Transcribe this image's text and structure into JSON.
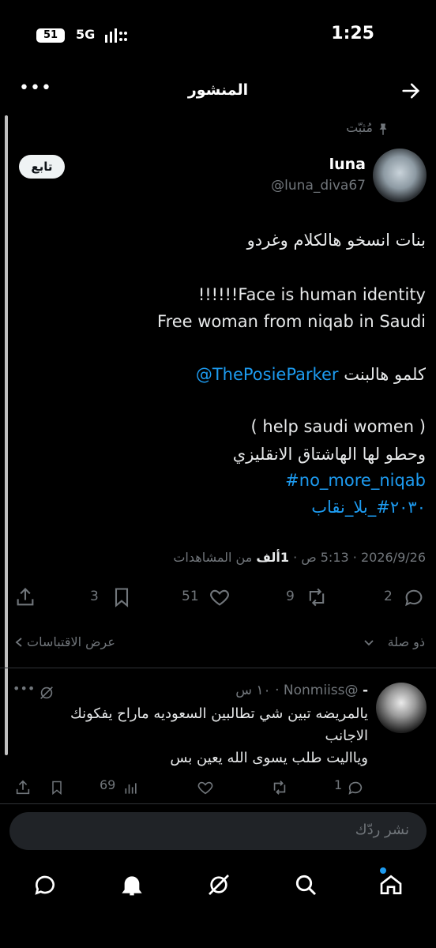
{
  "status_bar": {
    "time": "1:25",
    "battery": "51",
    "network": "5G"
  },
  "header": {
    "title": "المنشور"
  },
  "post": {
    "pinned_label": "مُثبّت",
    "author_name": "luna",
    "author_handle": "@luna_diva67",
    "follow_label": "تابع",
    "lines": {
      "l1": "بنات انسخو هالكلام وغردو",
      "l2": "!!!!!!Face is human identity",
      "l3": "Free woman from niqab in Saudi",
      "l4_mention": "@ThePosieParker",
      "l4_text": "كلمو هالبنت",
      "l5": "( help saudi women )",
      "l6": "وحطو لها الهاشتاق الانقليزي",
      "l7": "#no_more_niqab",
      "l8": "#۲۰۳۰_بلا_نقاب"
    },
    "meta": {
      "date": "2026/9/26",
      "time": "5:13 ص",
      "views": "1ألف",
      "views_label": "من المشاهدات"
    },
    "counts": {
      "replies": "2",
      "reposts": "9",
      "likes": "51",
      "bookmarks": "3"
    },
    "related_label": "ذو صلة",
    "quotes_label": "عرض الاقتباسات"
  },
  "reply": {
    "handle": "@Nonmiiss",
    "time_ago": "١٠ س",
    "text_l1": "يالمريضه تبين شي تطالبين السعوديه ماراح يفكونك",
    "text_l2": "الاجانب",
    "text_l3": "ويااليت طلب يسوى الله يعين بس",
    "counts": {
      "replies": "1",
      "views": "69"
    }
  },
  "composer": {
    "placeholder": "نشر ردّك"
  },
  "icons": [
    "arrow-right-icon",
    "more-icon",
    "pin-icon",
    "reply-icon",
    "repost-icon",
    "like-icon",
    "bookmark-icon",
    "share-icon",
    "grok-icon",
    "chevron-down-icon",
    "chevron-left-icon",
    "home-icon",
    "search-icon",
    "notifications-icon",
    "messages-icon",
    "views-icon"
  ],
  "colors": {
    "accent": "#1d9bf0",
    "muted": "#71767b",
    "background": "#000000"
  }
}
